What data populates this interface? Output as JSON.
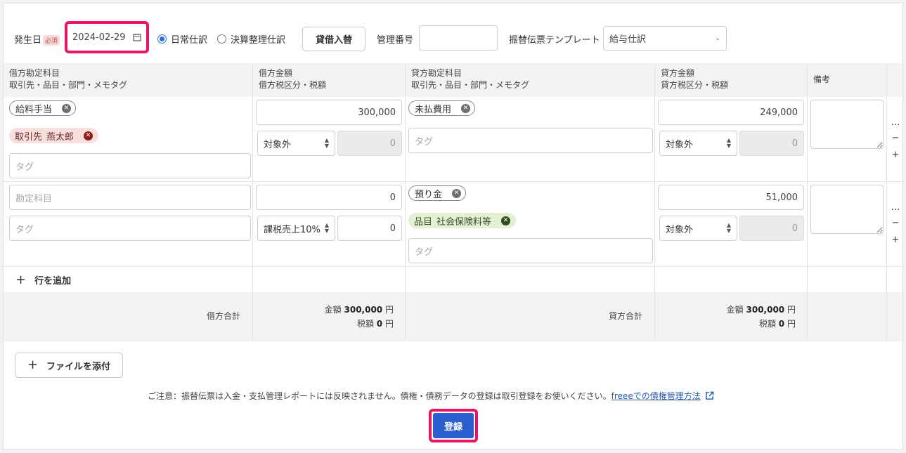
{
  "header": {
    "date_label": "発生日",
    "required_badge": "必須",
    "date_value": "2024-02-29",
    "radio_normal": "日常仕訳",
    "radio_adjust": "決算整理仕訳",
    "swap_button": "貸借入替",
    "mgmt_label": "管理番号",
    "mgmt_value": "",
    "template_label": "振替伝票テンプレート",
    "template_value": "給与仕訳"
  },
  "columns": {
    "debit_account": "借方勘定科目",
    "debit_account_sub": "取引先・品目・部門・メモタグ",
    "debit_amount": "借方金額",
    "debit_amount_sub": "借方税区分・税額",
    "credit_account": "貸方勘定科目",
    "credit_account_sub": "取引先・品目・部門・メモタグ",
    "credit_amount": "貸方金額",
    "credit_amount_sub": "貸方税区分・税額",
    "memo": "備考"
  },
  "rows": [
    {
      "debit_account": "給料手当",
      "debit_tag_label": "取引先",
      "debit_tag_value": "燕太郎",
      "debit_tag_placeholder": "タグ",
      "debit_amount": "300,000",
      "debit_tax_class": "対象外",
      "debit_tax": "0",
      "credit_account": "未払費用",
      "credit_tag_placeholder": "タグ",
      "credit_amount": "249,000",
      "credit_tax_class": "対象外",
      "credit_tax": "0"
    },
    {
      "debit_account_placeholder": "勘定科目",
      "debit_tag_placeholder": "タグ",
      "debit_amount": "0",
      "debit_tax_class": "課税売上10%",
      "debit_tax": "0",
      "credit_account": "預り金",
      "credit_tag_label": "品目",
      "credit_tag_value": "社会保険料等",
      "credit_tag_placeholder": "タグ",
      "credit_amount": "51,000",
      "credit_tax_class": "対象外",
      "credit_tax": "0"
    }
  ],
  "row_actions": {
    "more": "…",
    "remove": "−",
    "add": "+"
  },
  "add_row": "行を追加",
  "totals": {
    "debit_label": "借方合計",
    "credit_label": "貸方合計",
    "amount_label": "金額",
    "tax_label": "税額",
    "debit_amount": "300,000",
    "debit_tax": "0",
    "credit_amount": "300,000",
    "credit_tax": "0",
    "yen": "円"
  },
  "attach_button": "ファイルを添付",
  "notice": "ご注意：振替伝票は入金・支払管理レポートには反映されません。債権・債務データの登録は取引登録をお使いください。",
  "notice_link": "freeeでの債権管理方法",
  "submit_button": "登録",
  "colors": {
    "highlight": "#ea1465",
    "primary": "#2b5fd0"
  }
}
